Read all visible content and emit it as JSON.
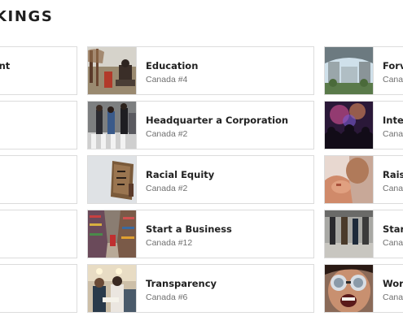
{
  "page": {
    "section_title": "KINGS"
  },
  "cards": {
    "left": [
      {
        "title": "ement",
        "rank": ""
      },
      {
        "title": "",
        "rank": ""
      },
      {
        "title": "",
        "rank": ""
      },
      {
        "title": "",
        "rank": ""
      },
      {
        "title": "",
        "rank": ""
      }
    ],
    "middle": [
      {
        "title": "Education",
        "rank": "Canada #4",
        "image": "campus-statue-photo"
      },
      {
        "title": "Headquarter a Corporation",
        "rank": "Canada #2",
        "image": "city-crosswalk-photo"
      },
      {
        "title": "Racial Equity",
        "rank": "Canada #2",
        "image": "protest-sign-photo"
      },
      {
        "title": "Start a Business",
        "rank": "Canada #12",
        "image": "grocery-aisle-photo"
      },
      {
        "title": "Transparency",
        "rank": "Canada #6",
        "image": "office-meeting-photo"
      }
    ],
    "right": [
      {
        "title": "Forv",
        "rank": "Canac",
        "image": "modern-building-photo"
      },
      {
        "title": "Inter",
        "rank": "Canac",
        "image": "fireworks-crowd-photo"
      },
      {
        "title": "Rais",
        "rank": "Canac",
        "image": "child-hands-photo"
      },
      {
        "title": "Star",
        "rank": "Canac",
        "image": "street-pedestrians-photo"
      },
      {
        "title": "Wor",
        "rank": "Canac",
        "image": "sunglasses-woman-photo"
      }
    ]
  }
}
